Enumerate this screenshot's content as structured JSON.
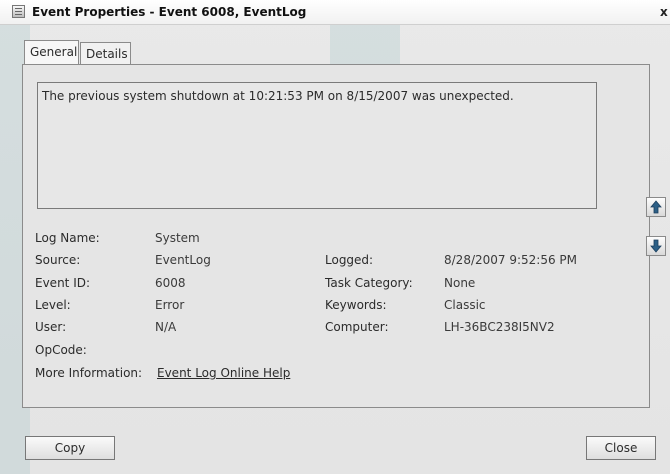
{
  "window": {
    "title": "Event Properties - Event 6008, EventLog",
    "close_glyph": "x"
  },
  "tabs": [
    {
      "label": "General",
      "selected": true
    },
    {
      "label": "Details",
      "selected": false
    }
  ],
  "description": "The previous system shutdown at 10:21:53 PM on 8/15/2007 was unexpected.",
  "fields": {
    "log_name": {
      "label": "Log Name:",
      "value": "System"
    },
    "source": {
      "label": "Source:",
      "value": "EventLog"
    },
    "event_id": {
      "label": "Event ID:",
      "value": "6008"
    },
    "level": {
      "label": "Level:",
      "value": "Error"
    },
    "user": {
      "label": "User:",
      "value": "N/A"
    },
    "opcode": {
      "label": "OpCode:",
      "value": ""
    },
    "more_info": {
      "label": "More Information:",
      "value": "Event Log Online Help"
    },
    "logged": {
      "label": "Logged:",
      "value": "8/28/2007 9:52:56 PM"
    },
    "task_category": {
      "label": "Task Category:",
      "value": "None"
    },
    "keywords": {
      "label": "Keywords:",
      "value": "Classic"
    },
    "computer": {
      "label": "Computer:",
      "value": "LH-36BC238I5NV2"
    }
  },
  "buttons": {
    "copy": "Copy",
    "close": "Close"
  },
  "icons": {
    "up": "arrow-up-icon",
    "down": "arrow-down-icon"
  }
}
